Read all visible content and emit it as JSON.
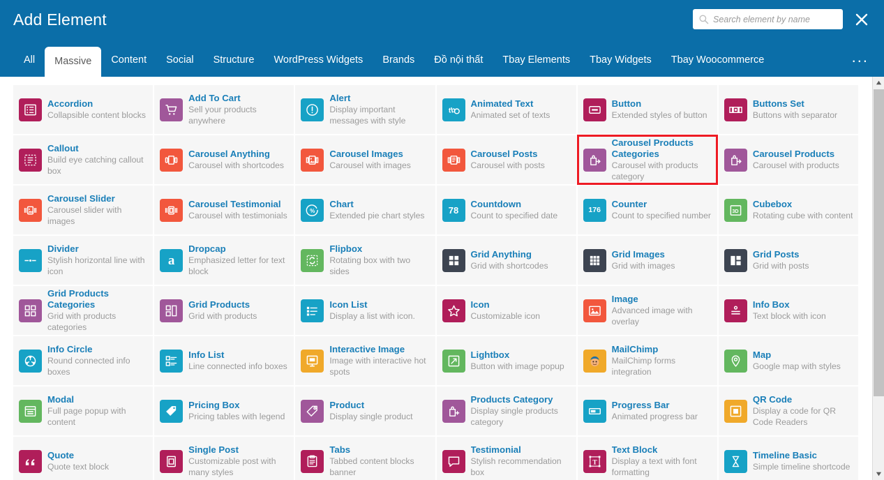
{
  "header": {
    "title": "Add Element",
    "search": {
      "placeholder": "Search element by name",
      "value": ""
    },
    "close_label": "close-icon",
    "more_label": "..."
  },
  "tabs": [
    {
      "label": "All",
      "active": false
    },
    {
      "label": "Massive",
      "active": true
    },
    {
      "label": "Content",
      "active": false
    },
    {
      "label": "Social",
      "active": false
    },
    {
      "label": "Structure",
      "active": false
    },
    {
      "label": "WordPress Widgets",
      "active": false
    },
    {
      "label": "Brands",
      "active": false
    },
    {
      "label": "Đồ nội thất",
      "active": false
    },
    {
      "label": "Tbay Elements",
      "active": false
    },
    {
      "label": "Tbay Widgets",
      "active": false
    },
    {
      "label": "Tbay Woocommerce",
      "active": false
    }
  ],
  "colors": {
    "header_blue": "#0b6ea8",
    "title_blue": "#1a7fb8",
    "selection_red": "#ee1b24",
    "magenta": "#b01e5a",
    "purple": "#a0579a",
    "cyan": "#17a2c6",
    "orange_red": "#f2573d",
    "green": "#63b75f",
    "dark_slate": "#3d4451",
    "amber": "#f0a92a"
  },
  "elements": [
    {
      "title": "Accordion",
      "desc": "Collapsible content blocks",
      "icon": "list-bullets-icon",
      "color": "#b01e5a"
    },
    {
      "title": "Add To Cart",
      "desc": "Sell your products anywhere",
      "icon": "shopping-cart-icon",
      "color": "#a0579a"
    },
    {
      "title": "Alert",
      "desc": "Display important messages with style",
      "icon": "exclamation-circle-icon",
      "color": "#17a2c6"
    },
    {
      "title": "Animated Text",
      "desc": "Animated set of texts",
      "icon": "animated-text-icon",
      "color": "#17a2c6"
    },
    {
      "title": "Button",
      "desc": "Extended styles of button",
      "icon": "button-icon",
      "color": "#b01e5a"
    },
    {
      "title": "Buttons Set",
      "desc": "Buttons with separator",
      "icon": "buttons-set-icon",
      "color": "#b01e5a"
    },
    {
      "title": "Callout",
      "desc": "Build eye catching callout box",
      "icon": "callout-box-icon",
      "color": "#b01e5a"
    },
    {
      "title": "Carousel Anything",
      "desc": "Carousel with shortcodes",
      "icon": "carousel-icon",
      "color": "#f2573d"
    },
    {
      "title": "Carousel Images",
      "desc": "Carousel with images",
      "icon": "carousel-image-icon",
      "color": "#f2573d"
    },
    {
      "title": "Carousel Posts",
      "desc": "Carousel with posts",
      "icon": "carousel-post-icon",
      "color": "#f2573d"
    },
    {
      "title": "Carousel Products Categories",
      "desc": "Carousel with products category",
      "icon": "products-category-bag-icon",
      "color": "#a0579a",
      "selected": true
    },
    {
      "title": "Carousel Products",
      "desc": "Carousel with products",
      "icon": "product-bag-icon",
      "color": "#a0579a"
    },
    {
      "title": "Carousel Slider",
      "desc": "Carousel slider with images",
      "icon": "carousel-slider-icon",
      "color": "#f2573d"
    },
    {
      "title": "Carousel Testimonial",
      "desc": "Carousel with testimonials",
      "icon": "carousel-testimonial-icon",
      "color": "#f2573d"
    },
    {
      "title": "Chart",
      "desc": "Extended pie chart styles",
      "icon": "pie-chart-percent-icon",
      "color": "#17a2c6"
    },
    {
      "title": "Countdown",
      "desc": "Count to specified date",
      "icon": "countdown-78-icon",
      "color": "#17a2c6",
      "num": "78"
    },
    {
      "title": "Counter",
      "desc": "Count to specified number",
      "icon": "counter-176-icon",
      "color": "#17a2c6",
      "num": "176"
    },
    {
      "title": "Cubebox",
      "desc": "Rotating cube with content",
      "icon": "cube-3d-icon",
      "color": "#63b75f",
      "num": "3D"
    },
    {
      "title": "Divider",
      "desc": "Stylish horizontal line with icon",
      "icon": "divider-icon",
      "color": "#17a2c6"
    },
    {
      "title": "Dropcap",
      "desc": "Emphasized letter for text block",
      "icon": "dropcap-a-icon",
      "color": "#17a2c6",
      "glyph": "a"
    },
    {
      "title": "Flipbox",
      "desc": "Rotating box with two sides",
      "icon": "flipbox-icon",
      "color": "#63b75f"
    },
    {
      "title": "Grid Anything",
      "desc": "Grid with shortcodes",
      "icon": "grid-four-icon",
      "color": "#3d4451"
    },
    {
      "title": "Grid Images",
      "desc": "Grid with images",
      "icon": "grid-nine-icon",
      "color": "#3d4451"
    },
    {
      "title": "Grid Posts",
      "desc": "Grid with posts",
      "icon": "grid-posts-icon",
      "color": "#3d4451"
    },
    {
      "title": "Grid Products Categories",
      "desc": "Grid with products categories",
      "icon": "grid-products-categories-icon",
      "color": "#a0579a"
    },
    {
      "title": "Grid Products",
      "desc": "Grid with products",
      "icon": "grid-products-icon",
      "color": "#a0579a"
    },
    {
      "title": "Icon List",
      "desc": "Display a list with icon.",
      "icon": "icon-list-icon",
      "color": "#17a2c6"
    },
    {
      "title": "Icon",
      "desc": "Customizable icon",
      "icon": "star-icon",
      "color": "#b01e5a"
    },
    {
      "title": "Image",
      "desc": "Advanced image with overlay",
      "icon": "image-icon",
      "color": "#f2573d"
    },
    {
      "title": "Info Box",
      "desc": "Text block with icon",
      "icon": "info-box-icon",
      "color": "#b01e5a"
    },
    {
      "title": "Info Circle",
      "desc": "Round connected info boxes",
      "icon": "info-circle-icon",
      "color": "#17a2c6"
    },
    {
      "title": "Info List",
      "desc": "Line connected info boxes",
      "icon": "info-list-icon",
      "color": "#17a2c6"
    },
    {
      "title": "Interactive Image",
      "desc": "Image with interactive hot spots",
      "icon": "interactive-image-icon",
      "color": "#f0a92a"
    },
    {
      "title": "Lightbox",
      "desc": "Button with image popup",
      "icon": "expand-arrows-icon",
      "color": "#63b75f"
    },
    {
      "title": "MailChimp",
      "desc": "MailChimp forms integration",
      "icon": "mailchimp-monkey-icon",
      "color": "#f0a92a"
    },
    {
      "title": "Map",
      "desc": "Google map with styles",
      "icon": "map-pin-icon",
      "color": "#63b75f"
    },
    {
      "title": "Modal",
      "desc": "Full page popup with content",
      "icon": "modal-window-icon",
      "color": "#63b75f"
    },
    {
      "title": "Pricing Box",
      "desc": "Pricing tables with legend",
      "icon": "price-tag-icon",
      "color": "#17a2c6"
    },
    {
      "title": "Product",
      "desc": "Display single product",
      "icon": "product-tag-icon",
      "color": "#a0579a"
    },
    {
      "title": "Products Category",
      "desc": "Display single products category",
      "icon": "products-category-icon",
      "color": "#a0579a"
    },
    {
      "title": "Progress Bar",
      "desc": "Animated progress bar",
      "icon": "progress-bar-icon",
      "color": "#17a2c6"
    },
    {
      "title": "QR Code",
      "desc": "Display a code for QR Code Readers",
      "icon": "qr-code-icon",
      "color": "#f0a92a"
    },
    {
      "title": "Quote",
      "desc": "Quote text block",
      "icon": "quote-marks-icon",
      "color": "#b01e5a"
    },
    {
      "title": "Single Post",
      "desc": "Customizable post with many styles",
      "icon": "single-post-icon",
      "color": "#b01e5a"
    },
    {
      "title": "Tabs",
      "desc": "Tabbed content blocks banner",
      "icon": "tabs-icon",
      "color": "#b01e5a"
    },
    {
      "title": "Testimonial",
      "desc": "Stylish recommendation box",
      "icon": "testimonial-bubble-icon",
      "color": "#b01e5a"
    },
    {
      "title": "Text Block",
      "desc": "Display a text with font formatting",
      "icon": "text-block-icon",
      "color": "#b01e5a"
    },
    {
      "title": "Timeline Basic",
      "desc": "Simple timeline shortcode",
      "icon": "hourglass-icon",
      "color": "#17a2c6"
    }
  ]
}
